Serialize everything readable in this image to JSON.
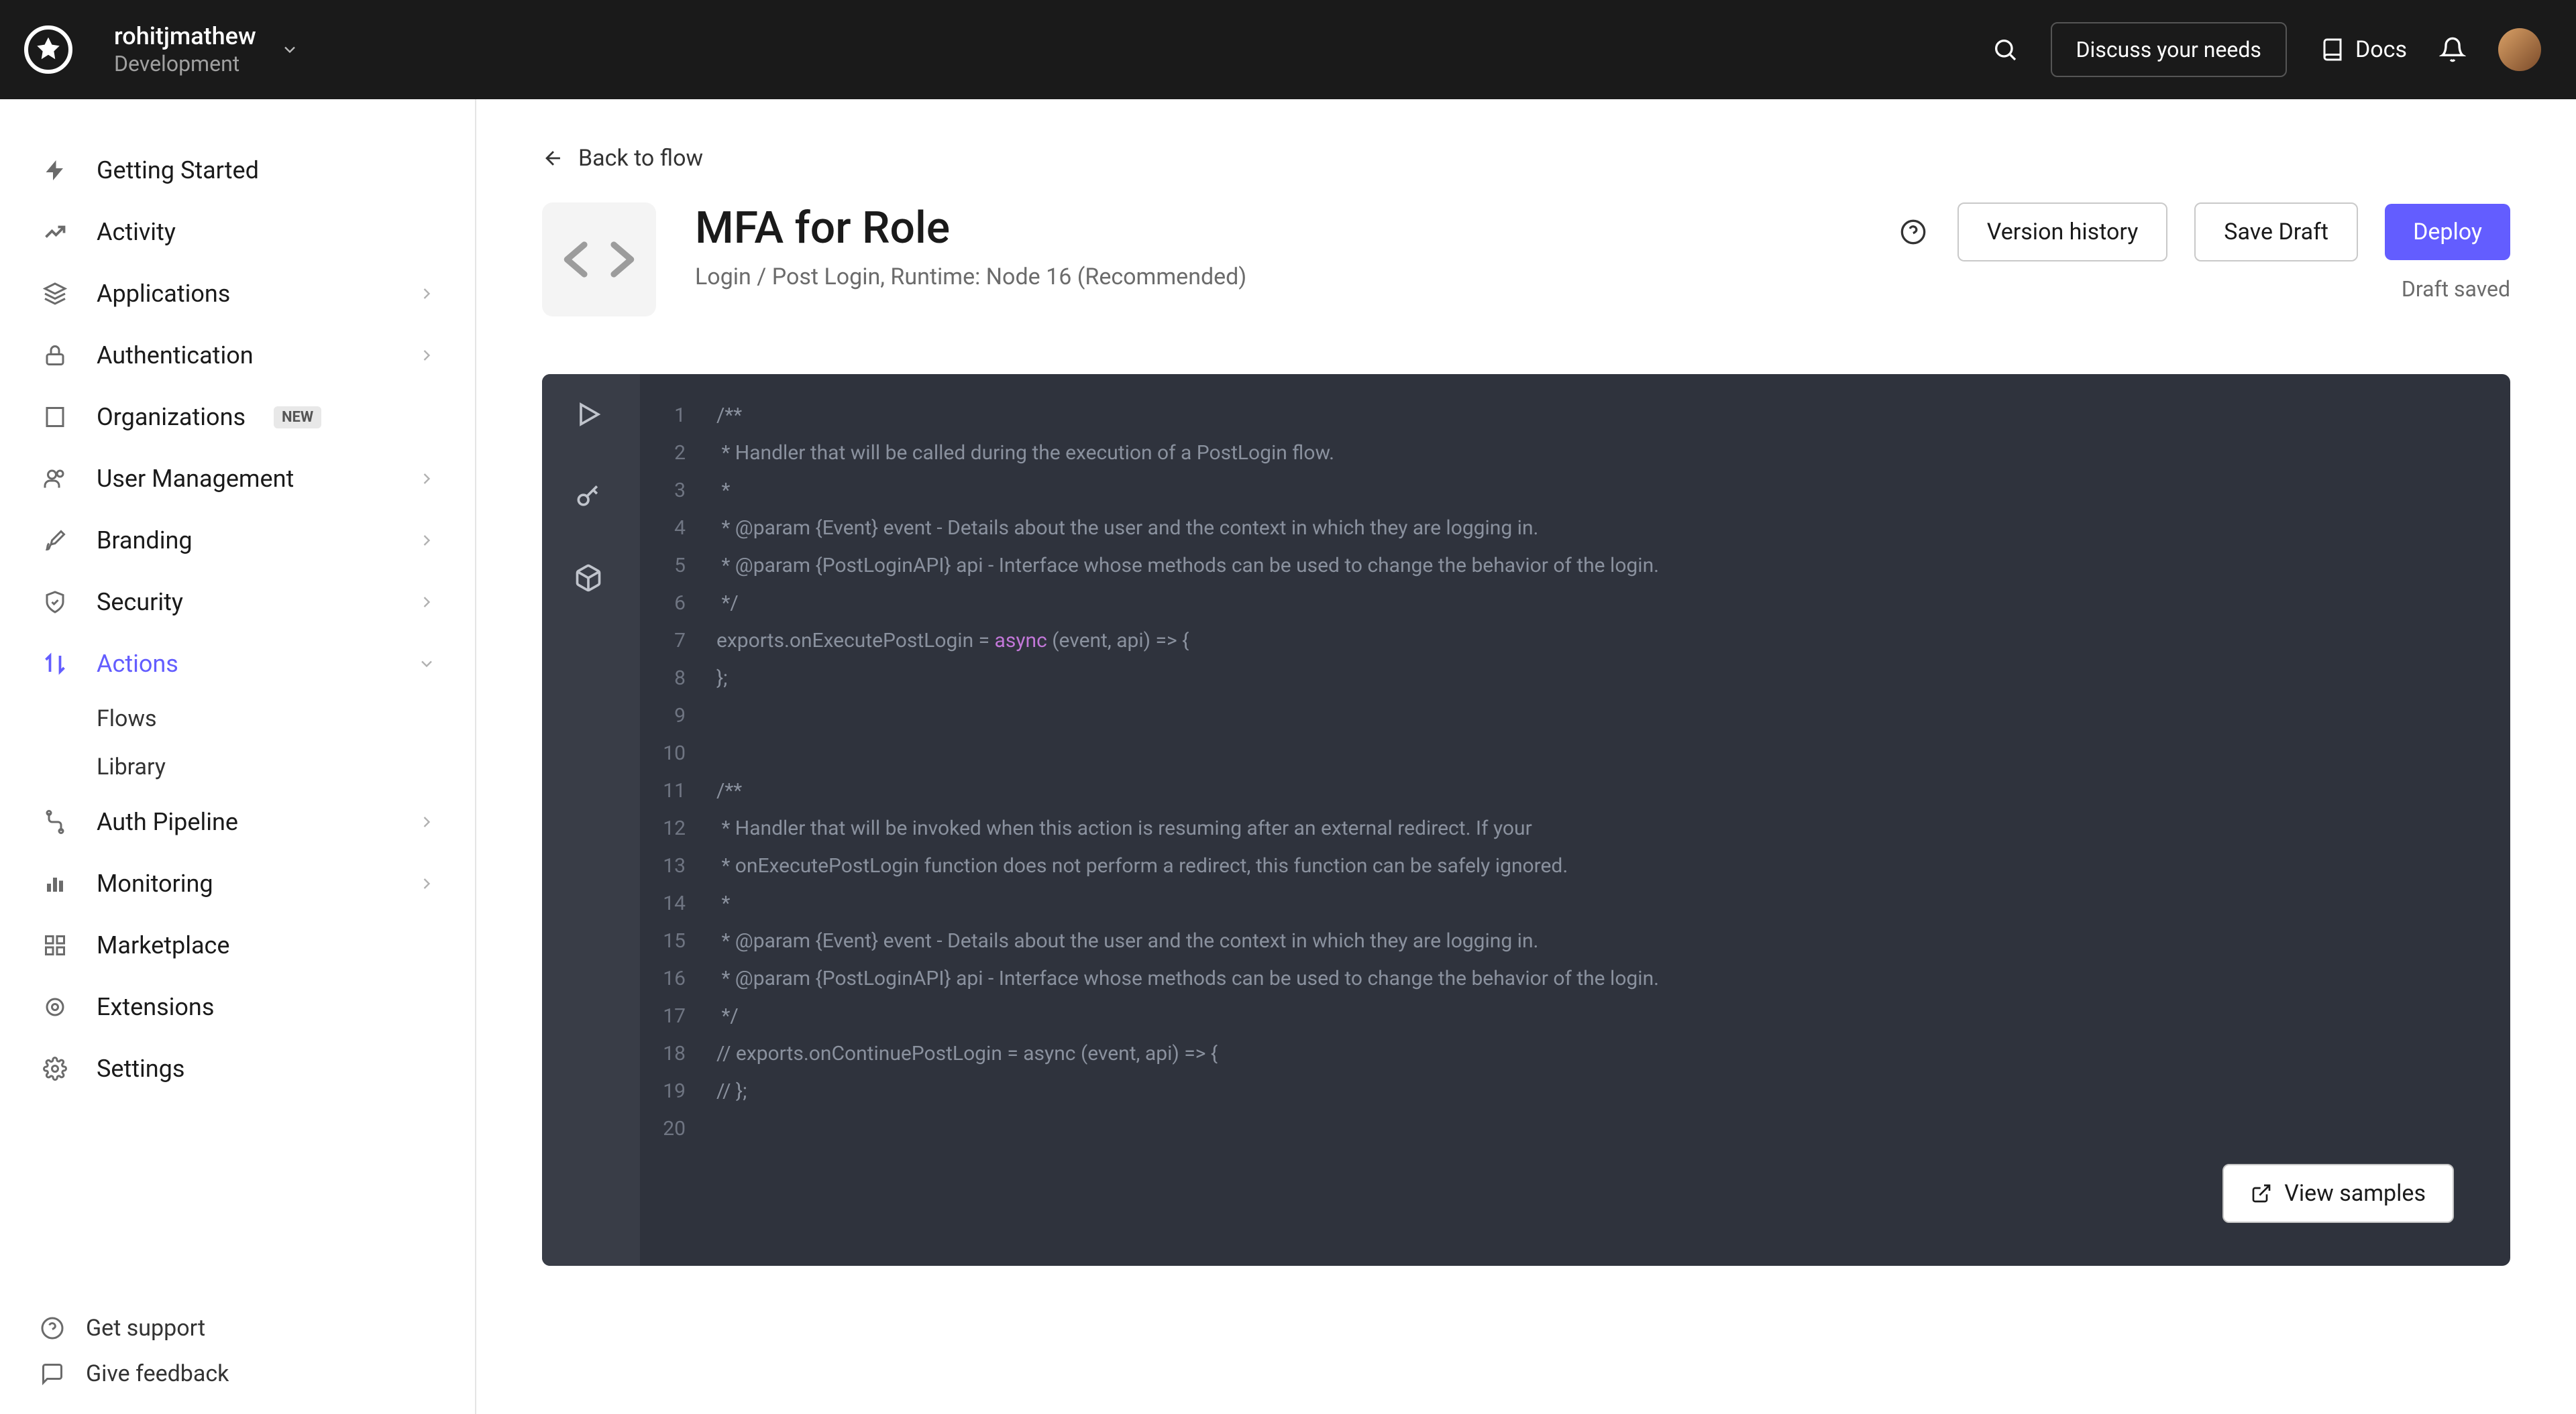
{
  "tenant": {
    "name": "rohitjmathew",
    "env": "Development"
  },
  "topbar": {
    "discuss": "Discuss your needs",
    "docs": "Docs"
  },
  "sidebar": {
    "items": [
      {
        "label": "Getting Started",
        "icon": "bolt",
        "caret": false
      },
      {
        "label": "Activity",
        "icon": "activity",
        "caret": false
      },
      {
        "label": "Applications",
        "icon": "stack",
        "caret": true
      },
      {
        "label": "Authentication",
        "icon": "lock",
        "caret": true
      },
      {
        "label": "Organizations",
        "icon": "building",
        "caret": false,
        "badge": "NEW"
      },
      {
        "label": "User Management",
        "icon": "users",
        "caret": true
      },
      {
        "label": "Branding",
        "icon": "brush",
        "caret": true
      },
      {
        "label": "Security",
        "icon": "shield",
        "caret": true
      },
      {
        "label": "Actions",
        "icon": "arrows",
        "caret": true,
        "active": true,
        "subitems": [
          {
            "label": "Flows"
          },
          {
            "label": "Library"
          }
        ]
      },
      {
        "label": "Auth Pipeline",
        "icon": "pipeline",
        "caret": true
      },
      {
        "label": "Monitoring",
        "icon": "bars",
        "caret": true
      },
      {
        "label": "Marketplace",
        "icon": "grid",
        "caret": false
      },
      {
        "label": "Extensions",
        "icon": "plug",
        "caret": false
      },
      {
        "label": "Settings",
        "icon": "gear",
        "caret": false
      }
    ],
    "footer": {
      "support": "Get support",
      "feedback": "Give feedback"
    }
  },
  "main": {
    "back": "Back to flow",
    "title": "MFA for Role",
    "subtitle": "Login / Post Login, Runtime: Node 16 (Recommended)",
    "buttons": {
      "version": "Version history",
      "save": "Save Draft",
      "deploy": "Deploy"
    },
    "status": "Draft saved",
    "samples": "View samples"
  },
  "code": {
    "lines": [
      "/**",
      " * Handler that will be called during the execution of a PostLogin flow.",
      " *",
      " * @param {Event} event - Details about the user and the context in which they are logging in.",
      " * @param {PostLoginAPI} api - Interface whose methods can be used to change the behavior of the login.",
      " */",
      "exports.onExecutePostLogin = |async| (event, api) => {",
      "};",
      "",
      "",
      "/**",
      " * Handler that will be invoked when this action is resuming after an external redirect. If your",
      " * onExecutePostLogin function does not perform a redirect, this function can be safely ignored.",
      " *",
      " * @param {Event} event - Details about the user and the context in which they are logging in.",
      " * @param {PostLoginAPI} api - Interface whose methods can be used to change the behavior of the login.",
      " */",
      "// exports.onContinuePostLogin = async (event, api) => {",
      "// };",
      ""
    ]
  }
}
